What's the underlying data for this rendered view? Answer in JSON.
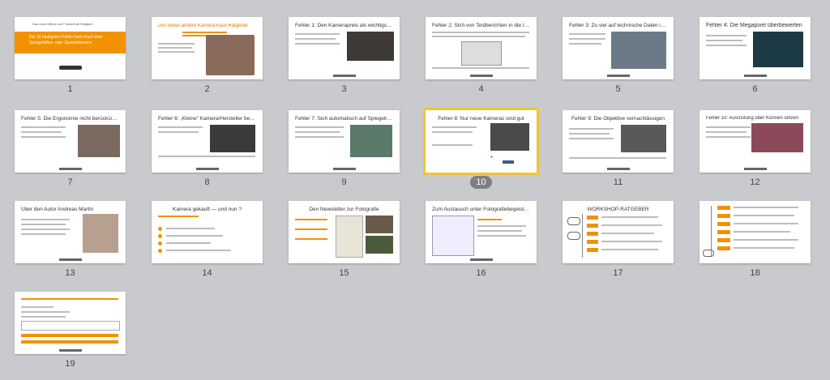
{
  "slides": [
    {
      "number": "1",
      "title": "Die 10 häufigsten Fehler beim Kauf einer Spiegelreflex- oder Systemkamera",
      "subtitle": "Das neue eBook von Fotoschule Stuttgart",
      "selected": false
    },
    {
      "number": "2",
      "title": "Der etwas andere Kamera-Kauf-Ratgeber",
      "selected": false
    },
    {
      "number": "3",
      "title": "Fehler 1: Den Kamerapreis als wichtigstes Kriterium festlegen",
      "selected": false
    },
    {
      "number": "4",
      "title": "Fehler 2: Sich von Testberichten in die Irre führen lassen",
      "selected": false
    },
    {
      "number": "5",
      "title": "Fehler 3: Zu viel auf technische Daten in der Werbung achten",
      "selected": false
    },
    {
      "number": "6",
      "title": "Fehler 4: Die Megapixel überbewerten",
      "selected": false
    },
    {
      "number": "7",
      "title": "Fehler 5: Die Ergonomie nicht berücksichtigen",
      "selected": false
    },
    {
      "number": "8",
      "title": "Fehler 6: „Kleine\" Kamera/Hersteller berücksichtigen",
      "selected": false
    },
    {
      "number": "9",
      "title": "Fehler 7: Sich automatisch auf Spiegelreflex-Kameras festlegen",
      "selected": false
    },
    {
      "number": "10",
      "title": "Fehler 8: Nur neue Kameras sind gut",
      "selected": true
    },
    {
      "number": "11",
      "title": "Fehler 9: Die Objektive vernachlässigen",
      "selected": false
    },
    {
      "number": "12",
      "title": "Fehler 10: Ausrüstung über Können setzen",
      "selected": false
    },
    {
      "number": "13",
      "title": "Über den Autor Andreas Martin",
      "selected": false
    },
    {
      "number": "14",
      "title": "Kamera gekauft — und nun ?",
      "selected": false
    },
    {
      "number": "15",
      "title": "Den Newsletter zur Fotografie",
      "selected": false
    },
    {
      "number": "16",
      "title": "Zum Austausch unter Fotografiebegeisterten",
      "selected": false
    },
    {
      "number": "17",
      "title": "WORKSHOP-RATGEBER",
      "selected": false
    },
    {
      "number": "18",
      "title": "",
      "selected": false
    },
    {
      "number": "19",
      "title": "",
      "selected": false
    }
  ],
  "colors": {
    "accent": "#f39200",
    "selection": "#f0c437",
    "background": "#c9cacd"
  }
}
